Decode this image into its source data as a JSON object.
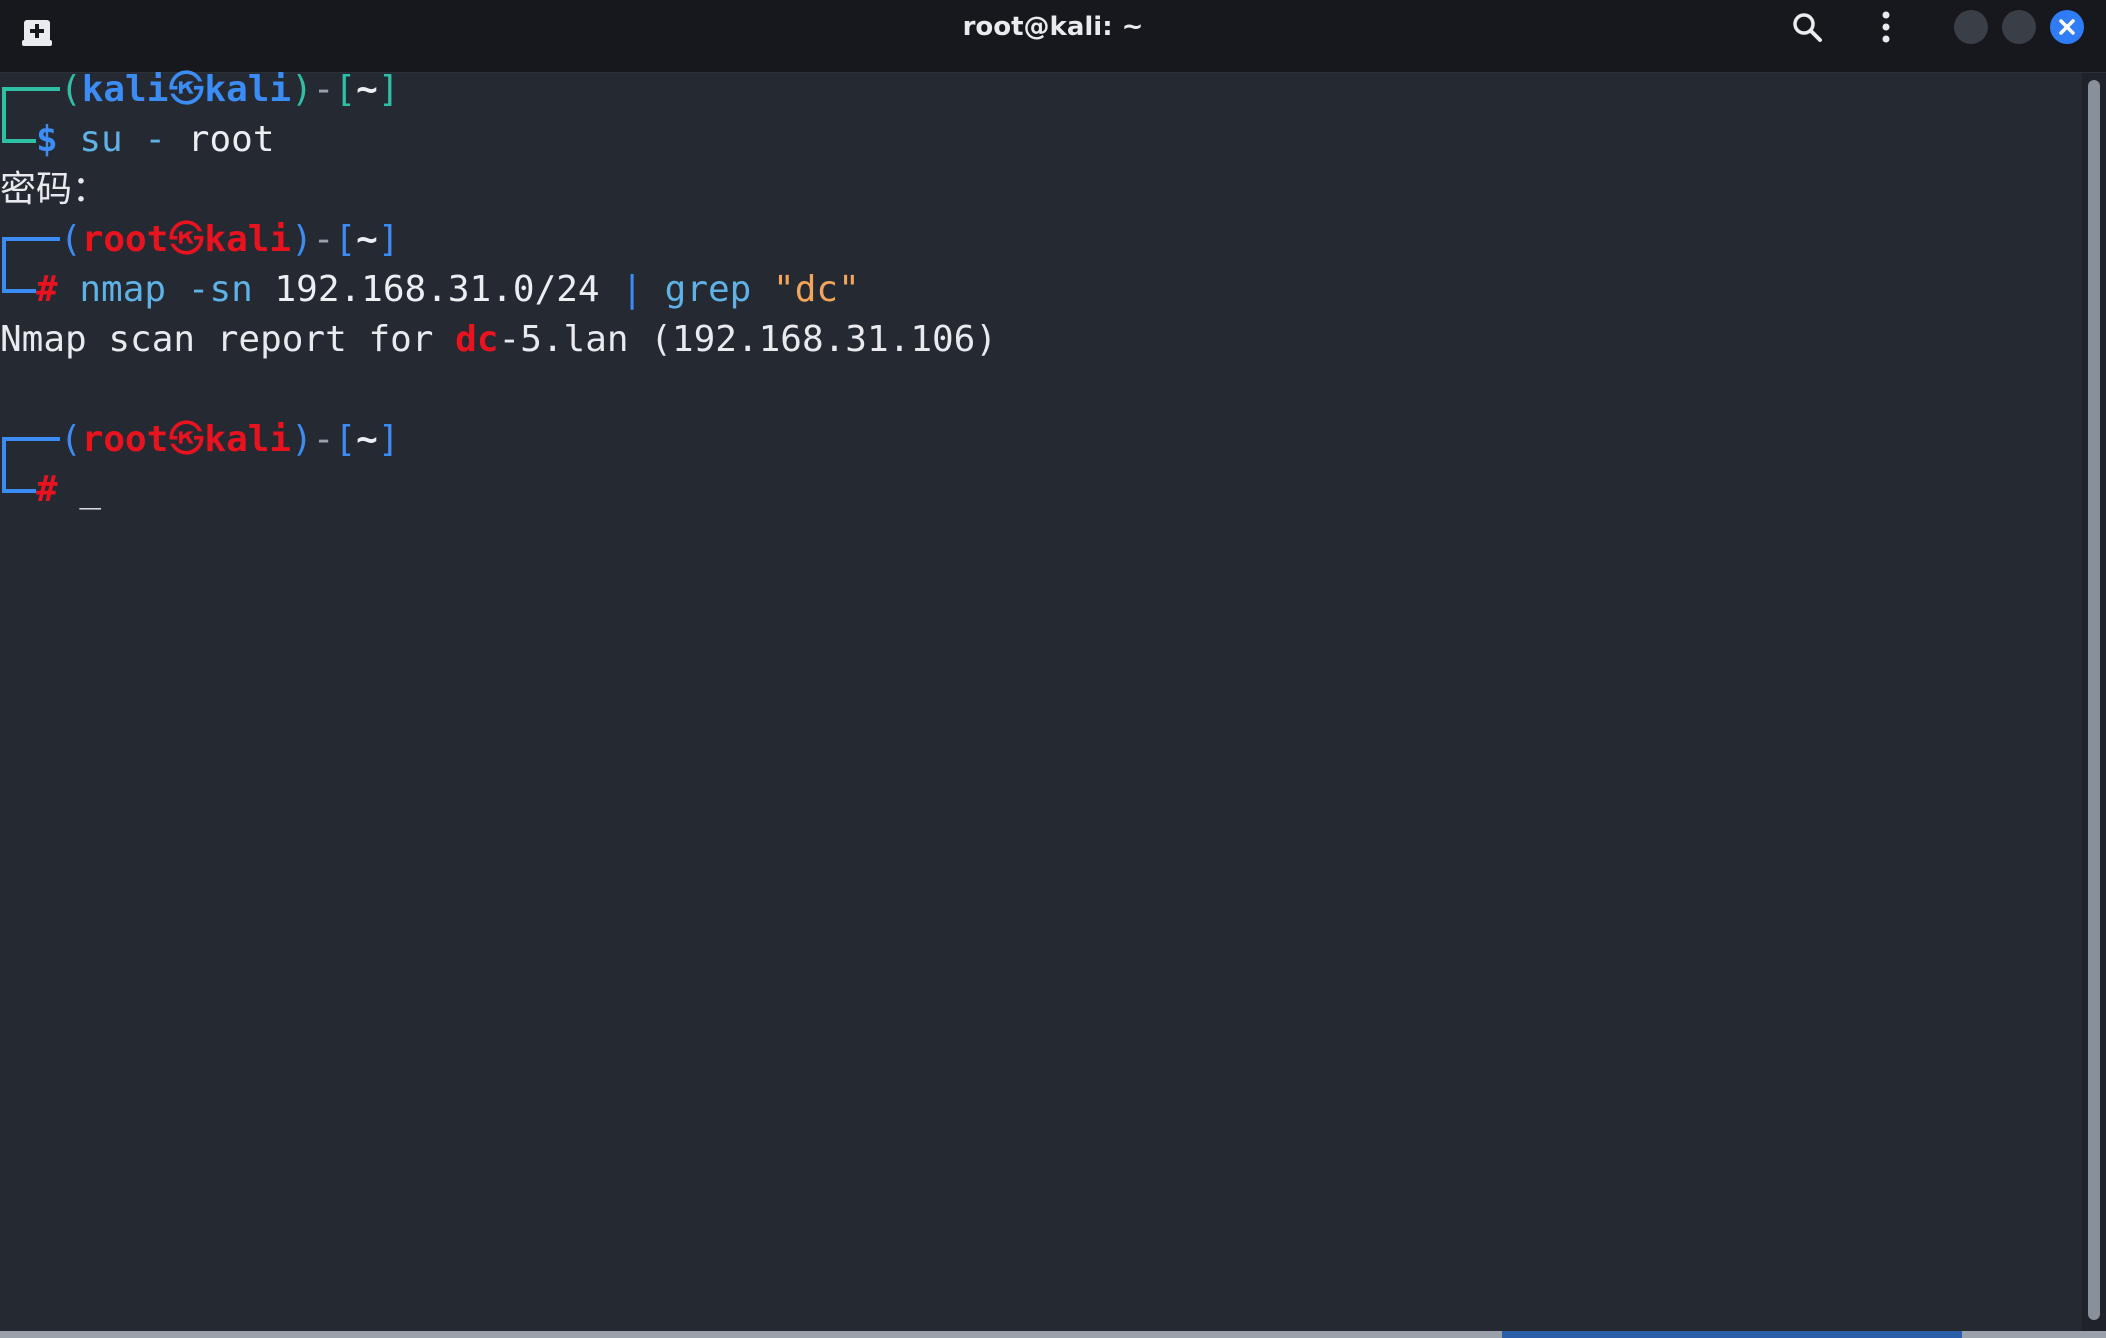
{
  "window": {
    "title": "root@kali: ~"
  },
  "icons": {
    "new_tab": "new-tab-icon",
    "search": "search-icon",
    "menu": "kebab-menu-icon",
    "minimize": "minimize-icon",
    "maximize": "maximize-icon",
    "close": "close-icon"
  },
  "colors": {
    "prompt_user_bracket": "#2fbfa5",
    "prompt_user": "#3c8cf5",
    "prompt_root": "#e8131f",
    "close_button": "#2f7cf6",
    "background": "#252932"
  },
  "terminal": {
    "prompt1": {
      "open": "(",
      "user": "kali",
      "symbol": "㉿",
      "host": "kali",
      "close": ")",
      "dash": "-",
      "dir_open": "[",
      "dir": "~",
      "dir_close": "]",
      "marker": "$",
      "cmd": "su",
      "cmd_arg1": "-",
      "cmd_arg2": "root"
    },
    "password_prompt": "密码：",
    "prompt2": {
      "open": "(",
      "user": "root",
      "symbol": "㉿",
      "host": "kali",
      "close": ")",
      "dash": "-",
      "dir_open": "[",
      "dir": "~",
      "dir_close": "]",
      "marker": "#",
      "cmd": "nmap",
      "cmd_arg1": "-sn",
      "cmd_arg2": "192.168.31.0/24",
      "pipe": "|",
      "cmd2": "grep",
      "cmd2_arg": "\"dc\""
    },
    "output": {
      "prefix": "Nmap scan report for ",
      "match": "dc",
      "suffix": "-5.lan (192.168.31.106)"
    },
    "prompt3": {
      "open": "(",
      "user": "root",
      "symbol": "㉿",
      "host": "kali",
      "close": ")",
      "dash": "-",
      "dir_open": "[",
      "dir": "~",
      "dir_close": "]",
      "marker": "#",
      "cursor": "_"
    }
  }
}
